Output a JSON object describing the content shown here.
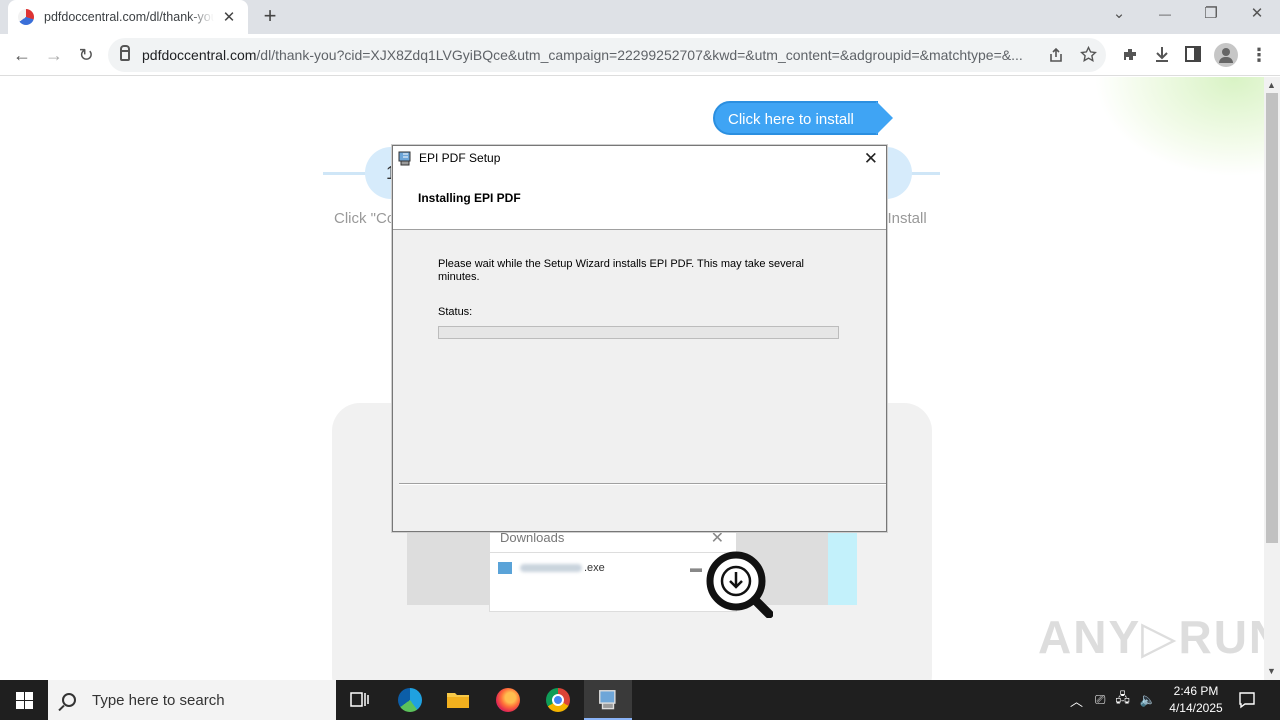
{
  "browser": {
    "tab_title": "pdfdoccentral.com/dl/thank-you",
    "tab_close": "✕",
    "new_tab": "+",
    "url_domain": "pdfdoccentral.com",
    "url_rest": "/dl/thank-you?cid=XJX8Zdq1LVGyiBQce&utm_campaign=22299252707&kwd=&utm_content=&adgroupid=&matchtype=&...",
    "controls": {
      "chevron": "⌄",
      "minimize": "—",
      "restore": "❐",
      "close": "✕"
    },
    "nav": {
      "back": "←",
      "forward": "→",
      "reload": "↻"
    }
  },
  "page": {
    "install_button": "Click here to install",
    "step_number": "1",
    "step1_text": "Click \"Co",
    "step3_text": "l Install",
    "downloads_title": "Downloads",
    "downloads_close": "✕",
    "download_file_suffix": ".exe",
    "watermark": "ANY▷RUN"
  },
  "dialog": {
    "title": "EPI PDF Setup",
    "close": "✕",
    "heading": "Installing EPI PDF",
    "message": "Please wait while the Setup Wizard installs EPI PDF.  This may take several minutes.",
    "status_label": "Status:",
    "progress": 0
  },
  "taskbar": {
    "search_placeholder": "Type here to search",
    "time": "2:46 PM",
    "date": "4/14/2025"
  }
}
